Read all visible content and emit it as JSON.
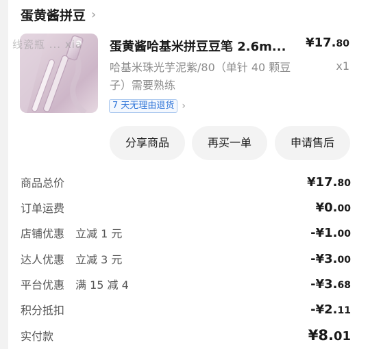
{
  "shop": {
    "name": "蛋黄酱拼豆",
    "arrow": "›"
  },
  "watermark": "线瓷瓶 ... xia",
  "product": {
    "title": "蛋黄酱哈基米拼豆豆笔 2.6m...",
    "price_int": "¥17.",
    "price_dec": "80",
    "spec": "哈基米珠光芋泥紫/80（单针 40 颗豆子）需要熟练",
    "qty": "x1",
    "return_tag": "7 天无理由退货",
    "return_arrow": "›"
  },
  "actions": {
    "share": "分享商品",
    "rebuy": "再买一单",
    "after_sale": "申请售后"
  },
  "summary": {
    "goods_total": {
      "label": "商品总价",
      "int": "¥17.",
      "dec": "80"
    },
    "shipping": {
      "label": "订单运费",
      "int": "¥0.",
      "dec": "00"
    },
    "shop_discount": {
      "label": "店铺优惠",
      "sub": "立减 1 元",
      "int": "-¥1.",
      "dec": "00"
    },
    "talent_discount": {
      "label": "达人优惠",
      "sub": "立减 3 元",
      "int": "-¥3.",
      "dec": "00"
    },
    "platform_discount": {
      "label": "平台优惠",
      "sub": "满 15 减 4",
      "int": "-¥3.",
      "dec": "68"
    },
    "points": {
      "label": "积分抵扣",
      "int": "-¥2.",
      "dec": "11"
    },
    "paid": {
      "label": "实付款",
      "int": "¥8.",
      "dec": "01"
    }
  },
  "colors": {
    "accent_blue": "#3478d9",
    "background": "#f2f2f2"
  },
  "icons": {
    "chevron": "chevron-right-icon"
  }
}
